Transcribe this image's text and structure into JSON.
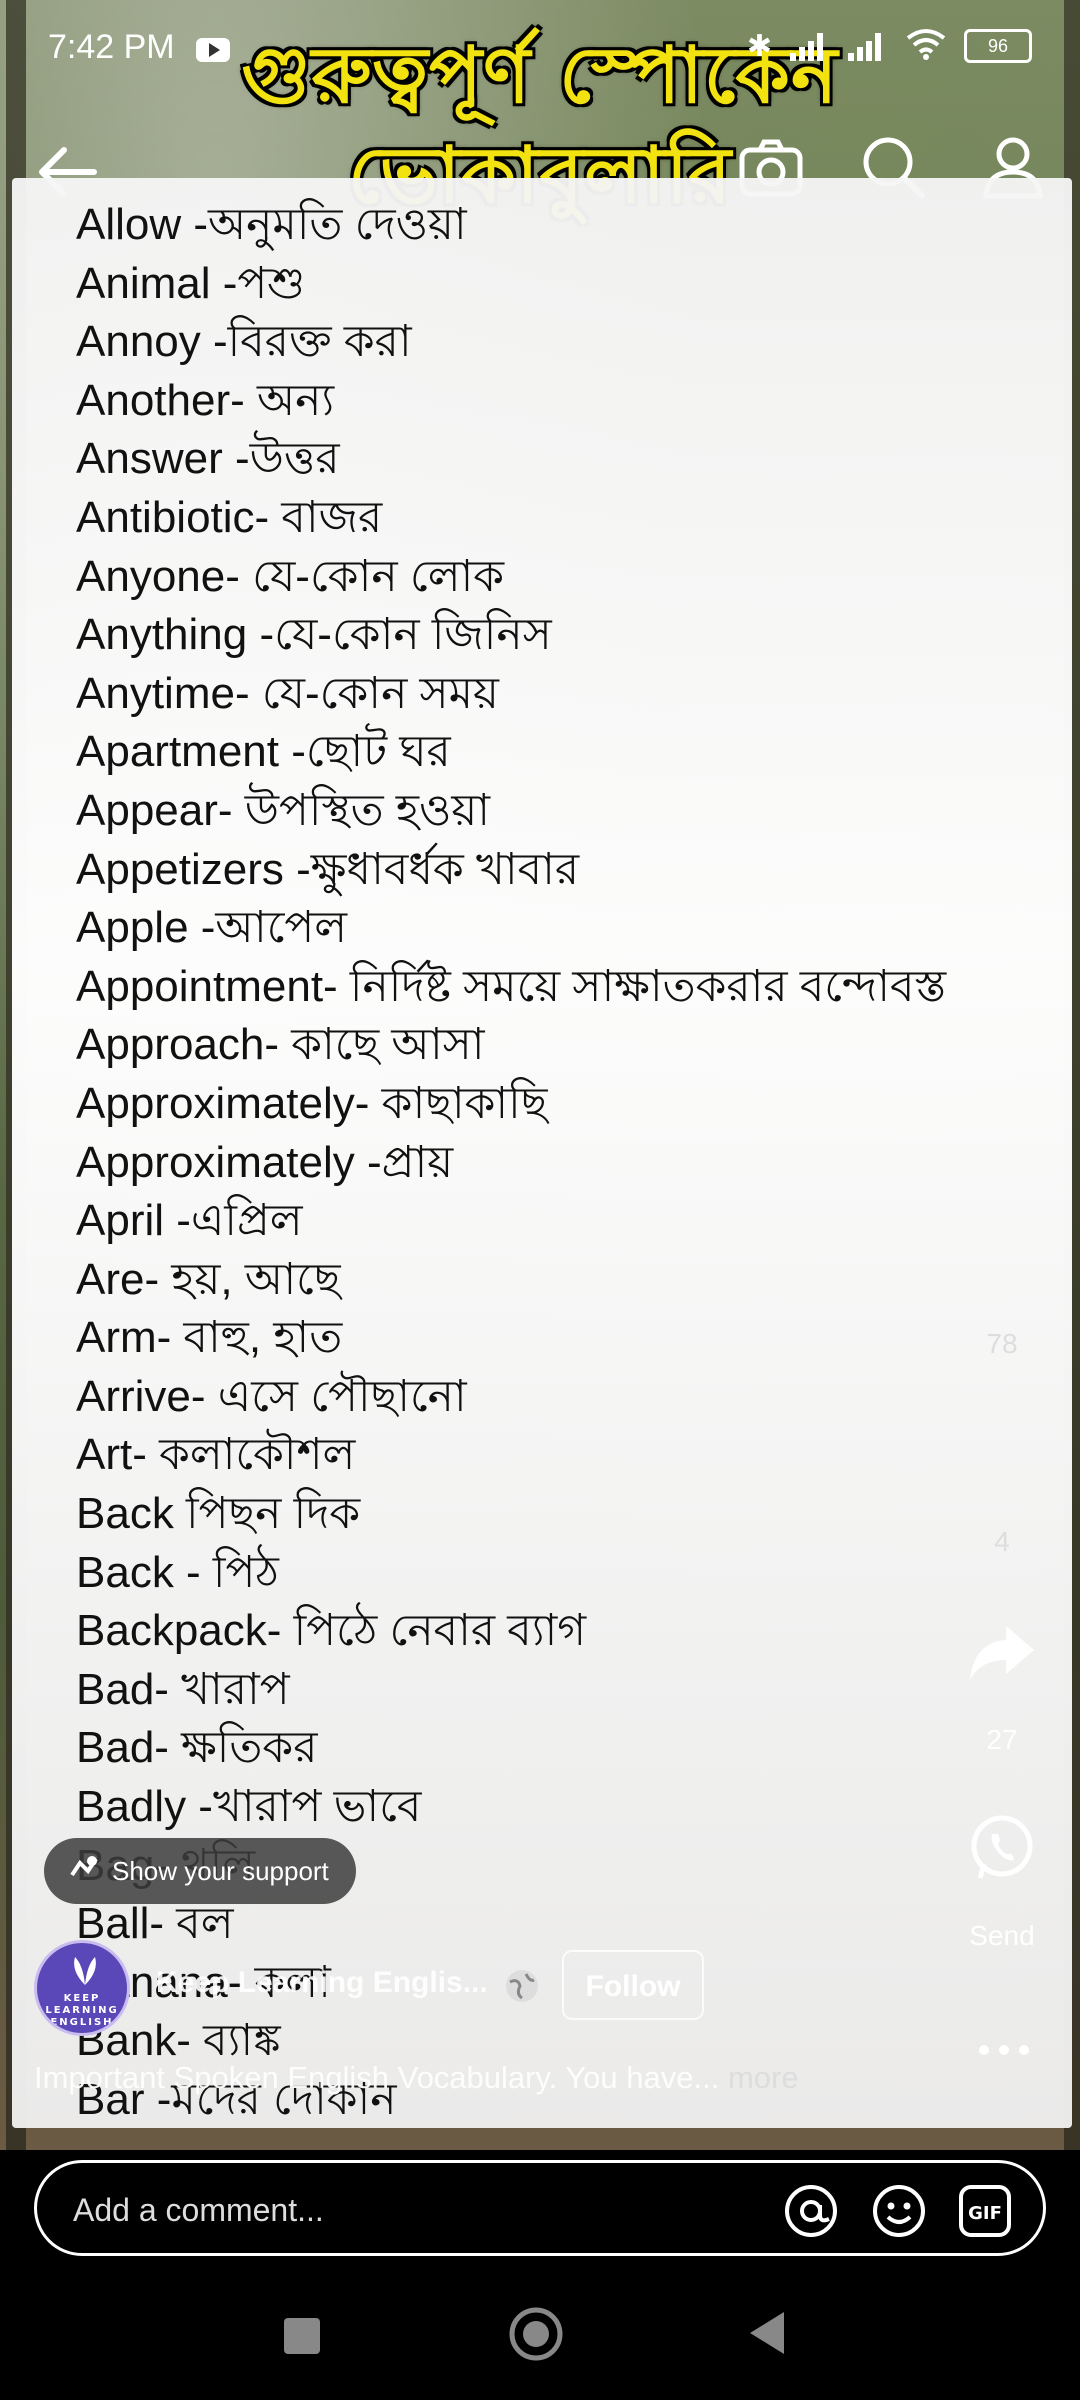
{
  "status": {
    "time": "7:42 PM",
    "battery": "96"
  },
  "banner": {
    "title": "গুরুত্বপূর্ণ স্পোকেন ভোকাবুলারি"
  },
  "words": [
    "Allow -অনুমতি দেওয়া",
    "Animal -পশু",
    "Annoy -বিরক্ত করা",
    "Another- অন্য",
    "Answer -উত্তর",
    "Antibiotic- বাজর",
    "Anyone- যে-কোন লোক",
    "Anything -যে-কোন জিনিস",
    "Anytime- যে-কোন সময়",
    "Apartment -ছোট ঘর",
    "Appear- উপস্থিত হওয়া",
    "Appetizers -ক্ষুধাবর্ধক খাবার",
    "Apple -আপেল",
    "Appointment- নির্দিষ্ট সময়ে সাক্ষাতকরার বন্দোবস্ত",
    "Approach- কাছে আসা",
    "Approximately- কাছাকাছি",
    "Approximately -প্রায়",
    "April -এপ্রিল",
    "Are- হয়, আছে",
    "Arm- বাহু, হাত",
    "Arrive- এসে পৌছানো",
    "Art- কলাকৌশল",
    "Back পিছন দিক",
    "Back - পিঠ",
    "Backpack- পিঠে নেবার ব্যাগ",
    "Bad- খারাপ",
    "Bad- ক্ষতিকর",
    "Badly -খারাপ ভাবে",
    "Bag- থলি",
    "Ball- বল",
    "Banana- কলা",
    "Bank- ব্যাঙ্ক",
    "Bar -মদের দোকান"
  ],
  "counts": {
    "likes": "78",
    "comments": "4",
    "shares": "27"
  },
  "actions": {
    "send_label": "Send"
  },
  "support": {
    "label": "Show your support"
  },
  "author": {
    "name": "Keep Learning Englis...",
    "avatar_text": "KEEP LEARNING ENGLISH",
    "follow_label": "Follow"
  },
  "caption": {
    "text": "Important Spoken English Vocabulary. You have...",
    "more": "more"
  },
  "comment": {
    "placeholder": "Add a comment..."
  },
  "icons": {
    "back": "arrow-left-icon",
    "camera": "camera-icon",
    "search": "search-icon",
    "profile": "profile-icon",
    "share": "share-icon",
    "send": "whatsapp-icon",
    "more": "more-icon",
    "globe": "globe-icon",
    "at": "at-icon",
    "emoji": "emoji-icon",
    "gif": "gif-icon"
  }
}
